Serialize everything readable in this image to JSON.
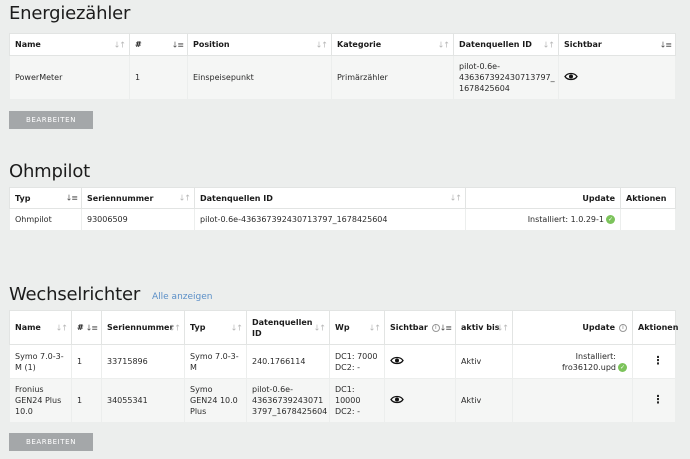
{
  "energiezaehler": {
    "title": "Energiezähler",
    "columns": [
      "Name",
      "#",
      "Position",
      "Kategorie",
      "Datenquellen ID",
      "Sichtbar"
    ],
    "row": {
      "name": "PowerMeter",
      "num": "1",
      "position": "Einspeisepunkt",
      "kategorie": "Primärzähler",
      "id1": "pilot-0.6e-",
      "id2": "436367392430713797_",
      "id3": "1678425604",
      "sichtbar_icon": "eye-icon"
    },
    "edit_button": "BEARBEITEN"
  },
  "ohmpilot": {
    "title": "Ohmpilot",
    "columns": [
      "Typ",
      "Seriennummer",
      "Datenquellen ID",
      "Update",
      "Aktionen"
    ],
    "row": {
      "typ": "Ohmpilot",
      "serial": "93006509",
      "id": "pilot-0.6e-436367392430713797_1678425604",
      "update": "Installiert: 1.0.29-1",
      "status_icon": "check-circle-icon"
    }
  },
  "wechselrichter": {
    "title": "Wechselrichter",
    "show_all": "Alle anzeigen",
    "columns": {
      "name": "Name",
      "num": "#",
      "serial": "Seriennummer",
      "typ": "Typ",
      "id1": "Datenquellen",
      "id2": "ID",
      "wp": "Wp",
      "sichtbar": "Sichtbar",
      "aktiv": "aktiv bis",
      "update": "Update",
      "aktionen": "Aktionen"
    },
    "rows": [
      {
        "name1": "Symo 7.0-3-",
        "name2": "M (1)",
        "num": "1",
        "serial": "33715896",
        "typ1": "Symo 7.0-3-",
        "typ2": "M",
        "id1": "240.1766114",
        "wp1": "DC1: 7000",
        "wp2": "DC2: -",
        "aktiv": "Aktiv",
        "update1": "Installiert:",
        "update2": "fro36120.upd"
      },
      {
        "name1": "Fronius",
        "name2": "GEN24 Plus",
        "name3": "10.0",
        "num": "1",
        "serial": "34055341",
        "typ1": "Symo",
        "typ2": "GEN24 10.0",
        "typ3": "Plus",
        "id1": "pilot-0.6e-",
        "id2": "43636739243071",
        "id3": "3797_1678425604",
        "wp1": "DC1: 10000",
        "wp2": "DC2: -",
        "aktiv": "Aktiv"
      }
    ],
    "edit_button": "BEARBEITEN"
  }
}
